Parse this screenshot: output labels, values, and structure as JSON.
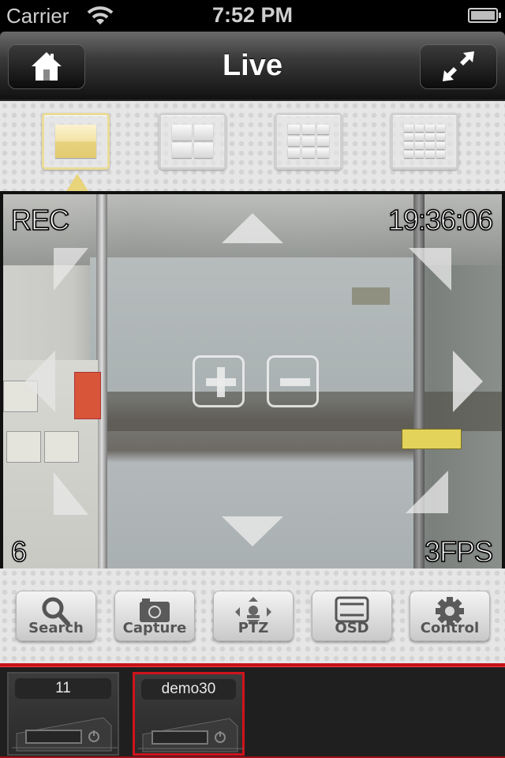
{
  "status_bar": {
    "carrier": "Carrier",
    "time": "7:52 PM",
    "battery_percent": 100
  },
  "nav": {
    "title": "Live",
    "left_button": "home-icon",
    "right_button": "fullscreen-icon"
  },
  "layouts": [
    {
      "name": "1-channel",
      "cells": 1,
      "active": true
    },
    {
      "name": "4-channel",
      "cells": 4,
      "active": false
    },
    {
      "name": "9-channel",
      "cells": 9,
      "active": false
    },
    {
      "name": "16-channel",
      "cells": 16,
      "active": false
    }
  ],
  "video": {
    "rec_label": "REC",
    "timestamp": "19:36:06",
    "channel": "6",
    "fps": "3FPS",
    "ptz_controls": [
      "up",
      "down",
      "left",
      "right",
      "up-left",
      "up-right",
      "down-left",
      "down-right",
      "zoom-in",
      "zoom-out"
    ]
  },
  "toolbar": {
    "buttons": [
      {
        "label": "Search",
        "icon": "search-icon"
      },
      {
        "label": "Capture",
        "icon": "camera-icon"
      },
      {
        "label": "PTZ",
        "icon": "ptz-icon"
      },
      {
        "label": "OSD",
        "icon": "osd-icon"
      },
      {
        "label": "Control",
        "icon": "gear-icon"
      }
    ]
  },
  "devices": [
    {
      "name": "11",
      "selected": false
    },
    {
      "name": "demo30",
      "selected": true
    }
  ],
  "colors": {
    "accent_red": "#c4121a",
    "active_layout": "#eadb98"
  }
}
